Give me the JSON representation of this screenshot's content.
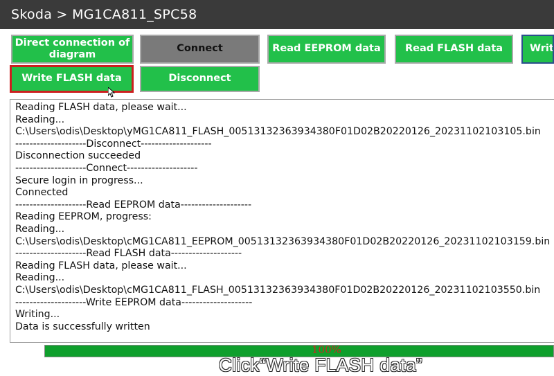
{
  "window": {
    "title": "Skoda > MG1CA811_SPC58"
  },
  "toolbar": {
    "direct_connection_label": "Direct connection of diagram",
    "connect_label": "Connect",
    "read_eeprom_label": "Read EEPROM data",
    "read_flash_label": "Read FLASH data",
    "write_eeprom_label": "Write EEPROM data",
    "write_flash_label": "Write FLASH data",
    "disconnect_label": "Disconnect"
  },
  "log": {
    "lines": [
      "Reading FLASH data, please wait...",
      "Reading...",
      "C:\\Users\\odis\\Desktop\\yMG1CA811_FLASH_00513132363934380F01D02B20220126_20231102103105.bin",
      "--------------------Disconnect--------------------",
      "Disconnection succeeded",
      "--------------------Connect--------------------",
      "Secure login in progress...",
      "Connected",
      "--------------------Read EEPROM data--------------------",
      "Reading EEPROM, progress:",
      "Reading...",
      "C:\\Users\\odis\\Desktop\\cMG1CA811_EEPROM_00513132363934380F01D02B20220126_20231102103159.bin",
      "--------------------Read FLASH data--------------------",
      "Reading FLASH data, please wait...",
      "Reading...",
      "C:\\Users\\odis\\Desktop\\cMG1CA811_FLASH_00513132363934380F01D02B20220126_20231102103550.bin",
      "--------------------Write EEPROM data--------------------",
      "Writing...",
      "Data is successfully written"
    ]
  },
  "progress": {
    "percent": 100,
    "label": "100%"
  },
  "caption": {
    "text": "Click“Write FLASH data”"
  },
  "colors": {
    "button_green": "#22c04a",
    "progress_green": "#0f9f2c",
    "highlight_red": "#cc1f1f"
  }
}
